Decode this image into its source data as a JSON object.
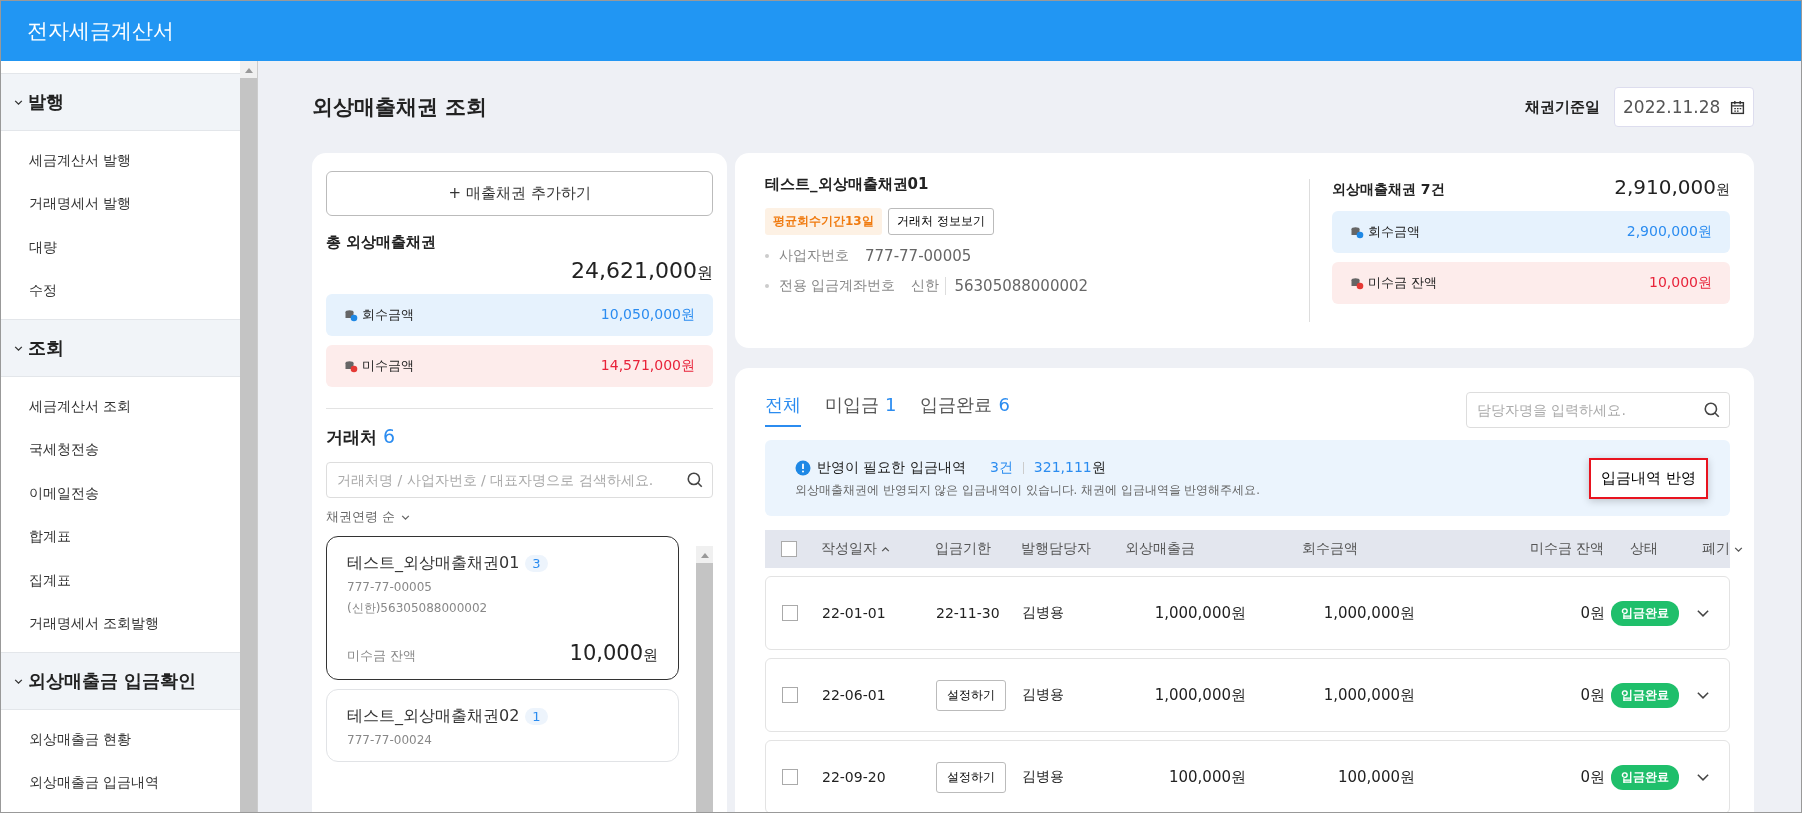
{
  "header": {
    "title": "전자세금계산서"
  },
  "sidebar": {
    "sections": [
      {
        "label": "발행",
        "expanded": true,
        "items": [
          "세금계산서 발행",
          "거래명세서 발행",
          "대량",
          "수정"
        ]
      },
      {
        "label": "조회",
        "expanded": true,
        "items": [
          "세금계산서 조회",
          "국세청전송",
          "이메일전송",
          "합계표",
          "집계표",
          "거래명세서 조회발행"
        ]
      },
      {
        "label": "외상매출금 입금확인",
        "expanded": true,
        "items": [
          "외상매출금 현황",
          "외상매출금 입금내역"
        ]
      }
    ]
  },
  "page": {
    "title": "외상매출채권 조회",
    "date_label": "채권기준일",
    "date_value": "2022.11.28"
  },
  "summary": {
    "add_button": "+ 매출채권 추가하기",
    "total_label": "총 외상매출채권",
    "total_amount": "24,621,000",
    "unit": "원",
    "boxes": [
      {
        "kind": "collected",
        "label": "회수금액",
        "amount": "10,050,000원"
      },
      {
        "kind": "unpaid",
        "label": "미수금액",
        "amount": "14,571,000원"
      }
    ]
  },
  "clients": {
    "label": "거래처",
    "count": "6",
    "search_placeholder": "거래처명 / 사업자번호 / 대표자명으로 검색하세요.",
    "sort": "채권연령 순",
    "items": [
      {
        "name": "테스트_외상매출채권01",
        "count": "3",
        "biz_no": "777-77-00005",
        "account": "(신한)56305088000002",
        "balance_label": "미수금 잔액",
        "balance": "10,000",
        "unit": "원",
        "selected": true
      },
      {
        "name": "테스트_외상매출채권02",
        "count": "1",
        "biz_no": "777-77-00024",
        "selected": false
      }
    ]
  },
  "detail": {
    "name": "테스트_외상매출채권01",
    "badge": "평균회수기간13일",
    "info_button": "거래처 정보보기",
    "fields": [
      {
        "label": "사업자번호",
        "value": "777-77-00005"
      },
      {
        "label": "전용 입금계좌번호",
        "bank": "신한",
        "value": "56305088000002"
      }
    ],
    "count_label": "외상매출채권 7건",
    "total": "2,910,000",
    "unit": "원",
    "boxes": [
      {
        "kind": "collected",
        "label": "회수금액",
        "amount": "2,900,000원"
      },
      {
        "kind": "unpaid",
        "label": "미수금 잔액",
        "amount": "10,000원"
      }
    ]
  },
  "tabs": [
    {
      "label": "전체",
      "selected": true
    },
    {
      "label": "미입금",
      "count": "1",
      "selected": false
    },
    {
      "label": "입금완료",
      "count": "6",
      "selected": false
    }
  ],
  "manager_search": {
    "placeholder": "담당자명을 입력하세요."
  },
  "notice": {
    "title": "반영이 필요한 입금내역",
    "count": "3건",
    "amount": "321,111",
    "unit": "원",
    "message": "외상매출채권에 반영되지 않은 입금내역이 있습니다. 채권에 입금내역을 반영해주세요.",
    "button": "입금내역 반영"
  },
  "table": {
    "all_checked": false,
    "columns": [
      {
        "label": "작성일자",
        "kind": "sortable"
      },
      {
        "label": "입금기한",
        "kind": "plain"
      },
      {
        "label": "발행담당자",
        "kind": "plain"
      },
      {
        "label": "외상매출금",
        "kind": "plain"
      },
      {
        "label": "회수금액",
        "kind": "plain"
      },
      {
        "label": "미수금 잔액",
        "kind": "plain"
      },
      {
        "label": "상태",
        "kind": "plain"
      },
      {
        "label": "폐기",
        "kind": "dropdown"
      }
    ],
    "rows": [
      {
        "checked": false,
        "date": "22-01-01",
        "deadline": {
          "kind": "text",
          "text": "22-11-30"
        },
        "manager": "김병용",
        "amount": "1,000,000원",
        "collected": "1,000,000원",
        "balance": "0원",
        "status": "입금완료"
      },
      {
        "checked": false,
        "date": "22-06-01",
        "deadline": {
          "kind": "button",
          "text": "설정하기"
        },
        "manager": "김병용",
        "amount": "1,000,000원",
        "collected": "1,000,000원",
        "balance": "0원",
        "status": "입금완료"
      },
      {
        "checked": false,
        "date": "22-09-20",
        "deadline": {
          "kind": "button",
          "text": "설정하기"
        },
        "manager": "김병용",
        "amount": "100,000원",
        "collected": "100,000원",
        "balance": "0원",
        "status": "입금완료"
      }
    ]
  }
}
